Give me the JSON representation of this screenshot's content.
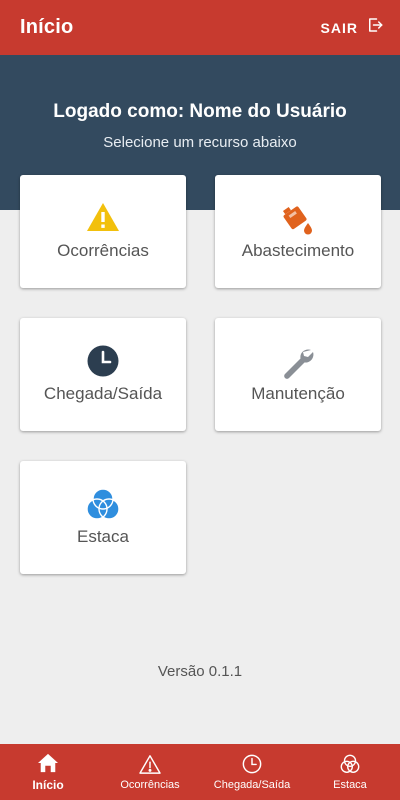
{
  "appbar": {
    "title": "Início",
    "logout_label": "SAIR"
  },
  "hero": {
    "user_line": "Logado como: Nome do Usuário",
    "subtitle": "Selecione um recurso abaixo"
  },
  "cards": [
    {
      "label": "Ocorrências",
      "icon": "warning-icon",
      "color": "#f2c00c"
    },
    {
      "label": "Abastecimento",
      "icon": "fuel-can-icon",
      "color": "#e0621d"
    },
    {
      "label": "Chegada/Saída",
      "icon": "clock-icon",
      "color": "#2c3e50"
    },
    {
      "label": "Manutenção",
      "icon": "wrench-icon",
      "color": "#8a8f96"
    },
    {
      "label": "Estaca",
      "icon": "venn-circles-icon",
      "color": "#2f8ede"
    }
  ],
  "version": "Versão 0.1.1",
  "bottom_nav": [
    {
      "label": "Início",
      "icon": "home-icon",
      "active": true
    },
    {
      "label": "Ocorrências",
      "icon": "warning-icon",
      "active": false
    },
    {
      "label": "Chegada/Saída",
      "icon": "clock-icon",
      "active": false
    },
    {
      "label": "Estaca",
      "icon": "venn-circles-icon",
      "active": false
    }
  ],
  "colors": {
    "primary": "#c73a2f",
    "hero": "#334a5f",
    "background": "#eeeeee"
  }
}
